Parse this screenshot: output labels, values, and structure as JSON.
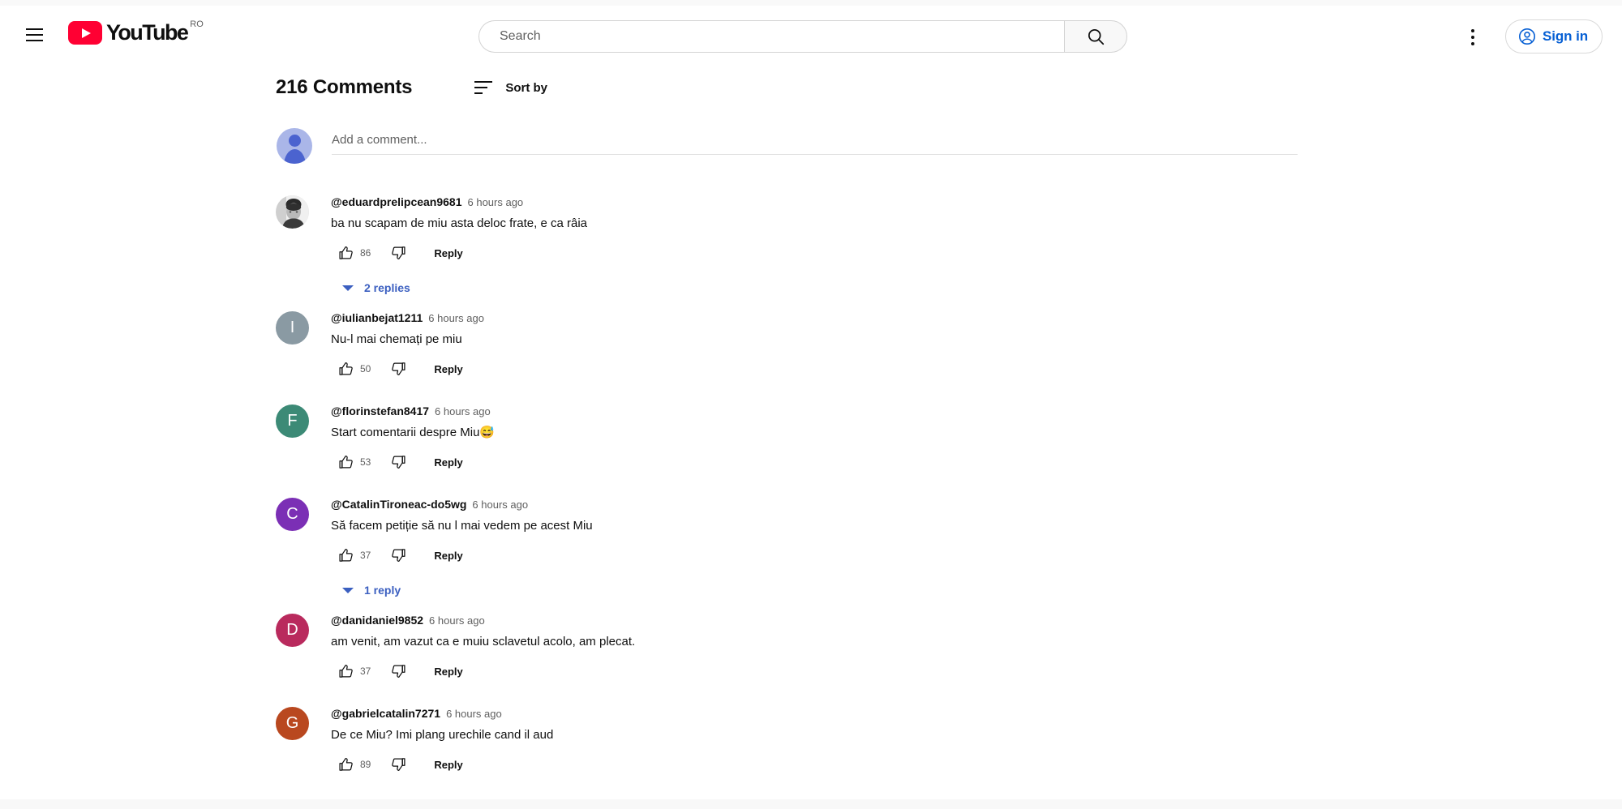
{
  "header": {
    "menu_icon": "hamburger-menu-icon",
    "logo_text": "YouTube",
    "logo_country": "RO",
    "search": {
      "placeholder": "Search",
      "value": "",
      "button_icon": "search-icon"
    },
    "more_icon": "kebab-menu-icon",
    "sign_in_label": "Sign in",
    "sign_in_icon": "account-circle-icon",
    "accent_blue": "#065fd4"
  },
  "comments_section": {
    "count_label": "216 Comments",
    "sort_label": "Sort by",
    "sort_icon": "sort-lines-icon",
    "add_comment_placeholder": "Add a comment...",
    "add_comment_value": "",
    "link_blue": "#3b5fc0"
  },
  "comments": [
    {
      "author": "@eduardprelipcean9681",
      "time": "6 hours ago",
      "text": "ba nu scapam de miu asta deloc frate, e ca râia",
      "likes": "86",
      "reply_label": "Reply",
      "avatar_type": "photo",
      "avatar_letter": "",
      "avatar_color": "#d8d8d8",
      "replies_label": "2 replies"
    },
    {
      "author": "@iulianbejat1211",
      "time": "6 hours ago",
      "text": "Nu-l mai chemați pe miu",
      "likes": "50",
      "reply_label": "Reply",
      "avatar_type": "letter",
      "avatar_letter": "I",
      "avatar_color": "#8a9aa3",
      "replies_label": ""
    },
    {
      "author": "@florinstefan8417",
      "time": "6 hours ago",
      "text": "Start comentarii despre Miu😅",
      "likes": "53",
      "reply_label": "Reply",
      "avatar_type": "letter",
      "avatar_letter": "F",
      "avatar_color": "#3c8a76",
      "replies_label": ""
    },
    {
      "author": "@CatalinTironeac-do5wg",
      "time": "6 hours ago",
      "text": "Să facem petiție să nu l mai vedem pe acest Miu",
      "likes": "37",
      "reply_label": "Reply",
      "avatar_type": "letter",
      "avatar_letter": "C",
      "avatar_color": "#7b2fb5",
      "replies_label": "1 reply"
    },
    {
      "author": "@danidaniel9852",
      "time": "6 hours ago",
      "text": "am venit, am vazut ca e muiu sclavetul acolo, am plecat.",
      "likes": "37",
      "reply_label": "Reply",
      "avatar_type": "letter",
      "avatar_letter": "D",
      "avatar_color": "#b92a5d",
      "replies_label": ""
    },
    {
      "author": "@gabrielcatalin7271",
      "time": "6 hours ago",
      "text": "De ce Miu? Imi plang urechile cand il aud",
      "likes": "89",
      "reply_label": "Reply",
      "avatar_type": "letter",
      "avatar_letter": "G",
      "avatar_color": "#b9481f",
      "replies_label": ""
    }
  ]
}
